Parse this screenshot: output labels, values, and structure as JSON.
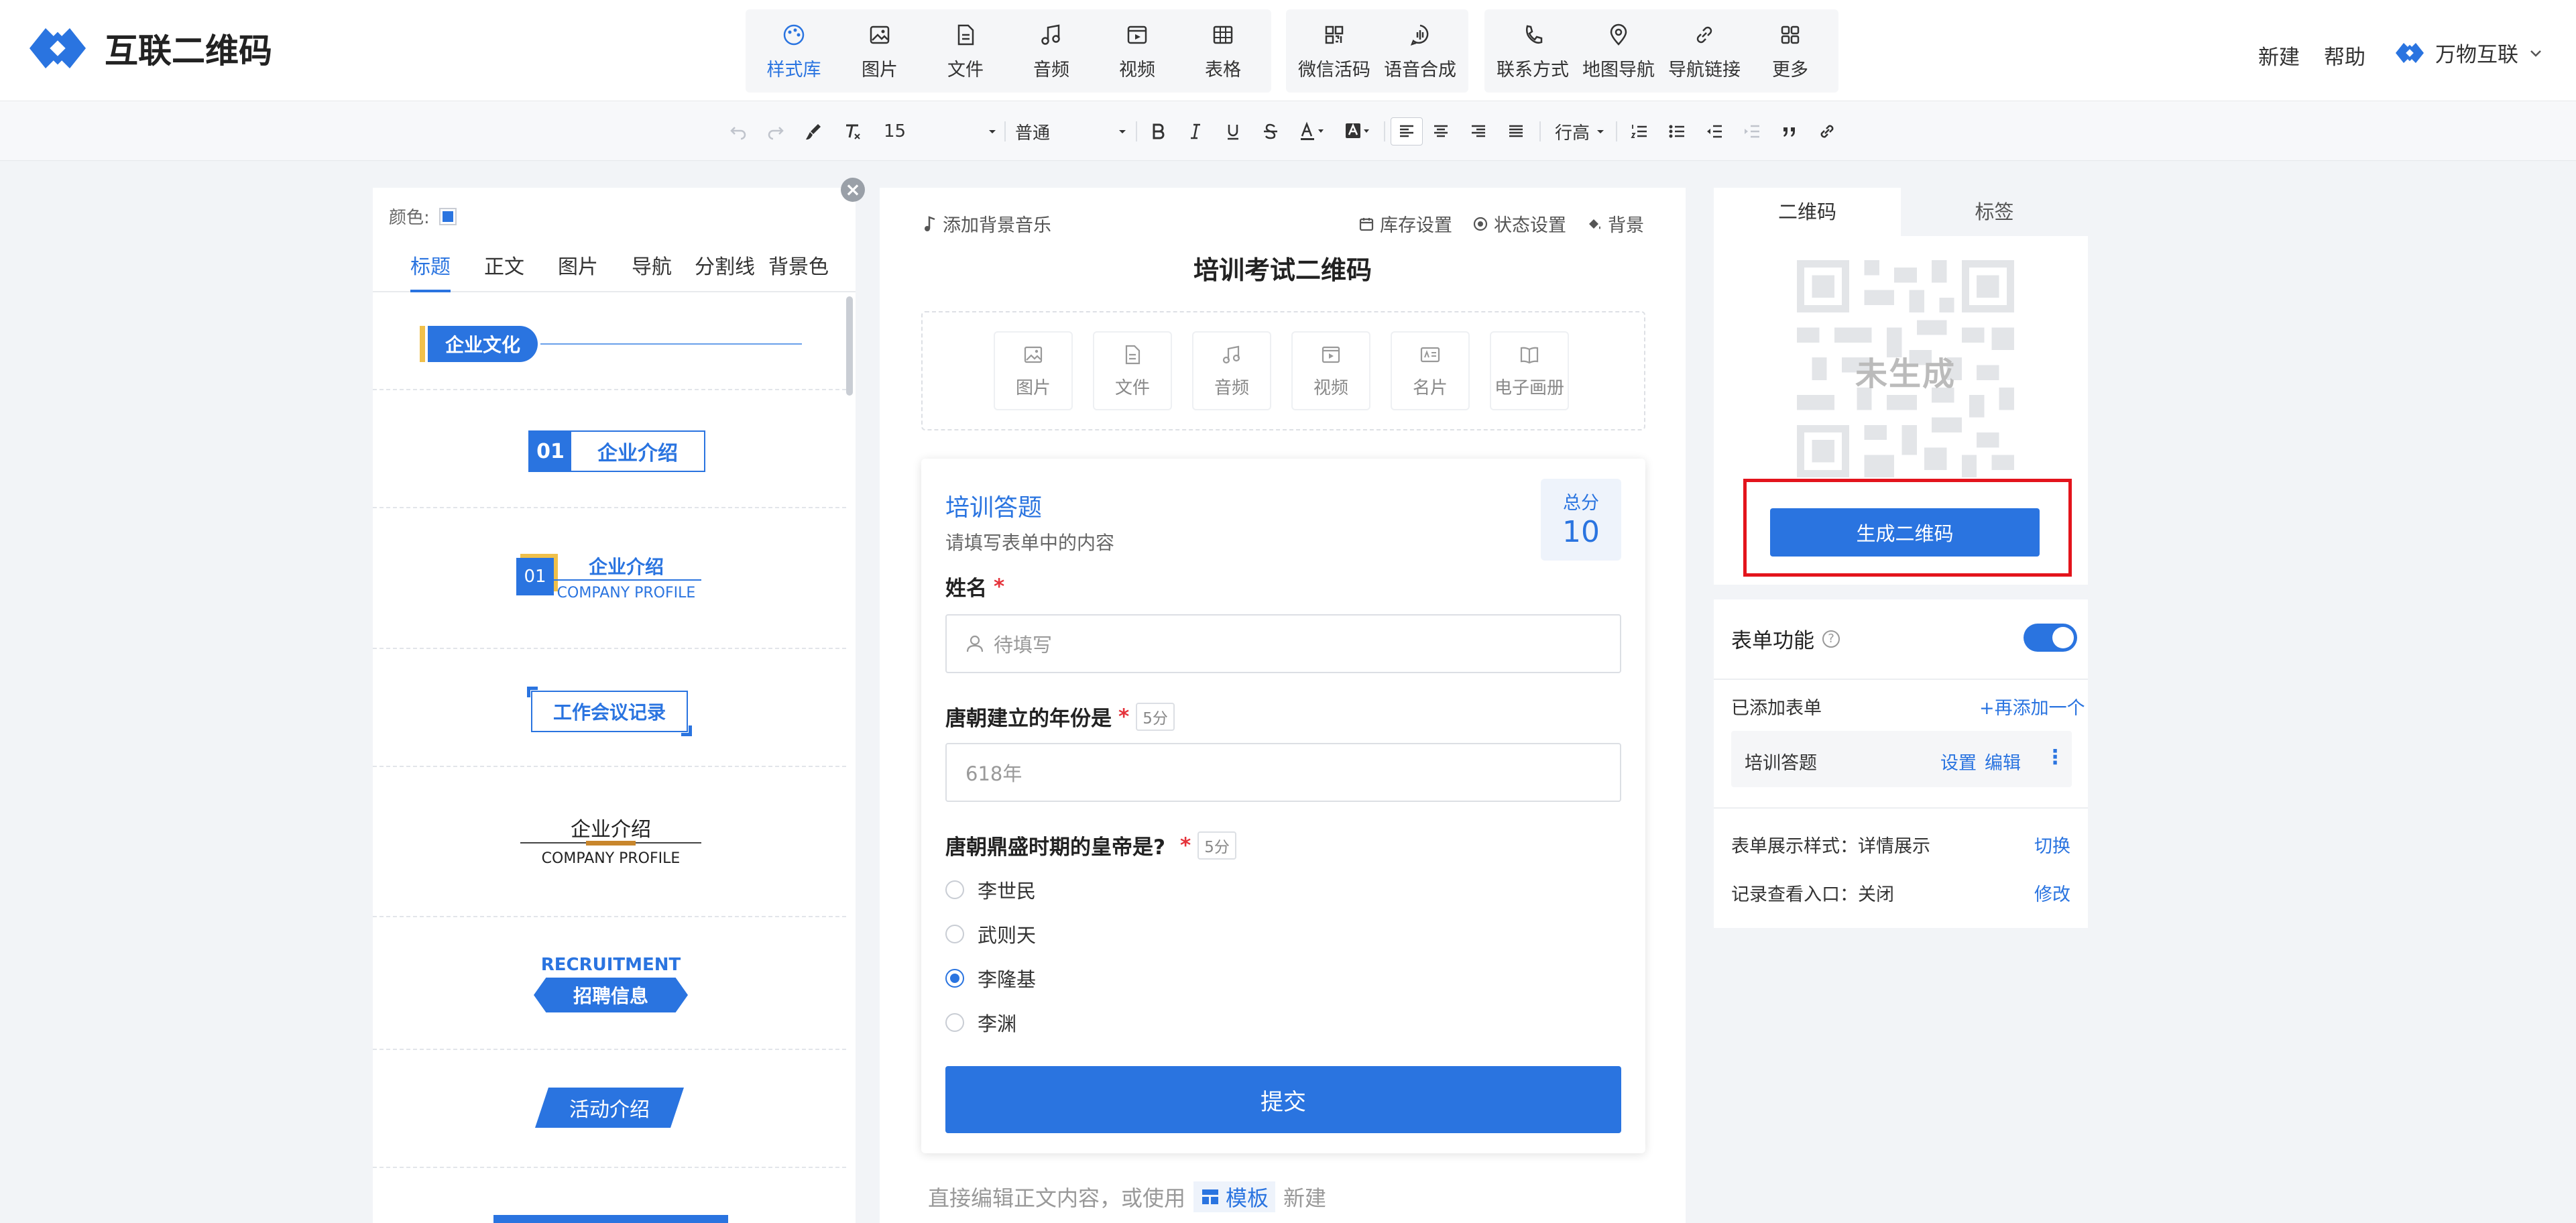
{
  "brand": {
    "name": "互联二维码",
    "color": "#2a74e0"
  },
  "toolbar": {
    "group1": [
      {
        "label": "样式库",
        "icon": "palette-icon",
        "active": true
      },
      {
        "label": "图片",
        "icon": "image-icon"
      },
      {
        "label": "文件",
        "icon": "file-icon"
      },
      {
        "label": "音频",
        "icon": "music-icon"
      },
      {
        "label": "视频",
        "icon": "video-icon"
      },
      {
        "label": "表格",
        "icon": "table-icon"
      }
    ],
    "group2": [
      {
        "label": "微信活码",
        "icon": "qr-small-icon"
      },
      {
        "label": "语音合成",
        "icon": "voice-icon"
      }
    ],
    "group3": [
      {
        "label": "联系方式",
        "icon": "phone-icon"
      },
      {
        "label": "地图导航",
        "icon": "location-icon"
      },
      {
        "label": "导航链接",
        "icon": "link-icon"
      },
      {
        "label": "更多",
        "icon": "grid-icon"
      }
    ]
  },
  "header_right": {
    "new": "新建",
    "help": "帮助",
    "account": "万物互联"
  },
  "format_bar": {
    "font_size": "15",
    "paragraph": "普通",
    "line_height": "行高"
  },
  "left_panel": {
    "color_label": "颜色:",
    "tabs": [
      "标题",
      "正文",
      "图片",
      "导航",
      "分割线",
      "背景色"
    ],
    "active_tab": 0,
    "cards": {
      "c1": "企业文化",
      "c2_num": "01",
      "c2_text": "企业介绍",
      "c3_num": "01",
      "c3_text": "企业介绍",
      "c3_sub": "COMPANY PROFILE",
      "c4": "工作会议记录",
      "c5_text": "企业介绍",
      "c5_sub": "COMPANY PROFILE",
      "c6_en": "RECRUITMENT",
      "c6_cn": "招聘信息",
      "c7": "活动介绍"
    }
  },
  "editor": {
    "bg_music": "添加背景音乐",
    "links": [
      "库存设置",
      "状态设置",
      "背景"
    ],
    "title": "培训考试二维码",
    "media": [
      "图片",
      "文件",
      "音频",
      "视频",
      "名片",
      "电子画册"
    ],
    "form": {
      "title": "培训答题",
      "desc": "请填写表单中的内容",
      "score_label": "总分",
      "score_value": "10",
      "q1": {
        "label": "姓名",
        "placeholder": "待填写"
      },
      "q2": {
        "label": "唐朝建立的年份是",
        "points": "5分",
        "value": "618年"
      },
      "q3": {
        "label": "唐朝鼎盛时期的皇帝是?",
        "points": "5分",
        "options": [
          "李世民",
          "武则天",
          "李隆基",
          "李渊"
        ],
        "selected": 2
      },
      "submit": "提交"
    },
    "bottom_hint_pre": "直接编辑正文内容，或使用",
    "bottom_hint_template": "模板",
    "bottom_hint_post": "新建"
  },
  "qr_panel": {
    "tabs": [
      "二维码",
      "标签"
    ],
    "status": "未生成",
    "generate": "生成二维码"
  },
  "form_panel": {
    "title": "表单功能",
    "enabled": true,
    "added_label": "已添加表单",
    "add_more": "+再添加一个",
    "item": {
      "name": "培训答题",
      "settings": "设置",
      "edit": "编辑",
      "more": "⋮"
    },
    "display_style": "表单展示样式：详情展示",
    "display_switch": "切换",
    "record_entry": "记录查看入口：关闭",
    "record_modify": "修改"
  }
}
